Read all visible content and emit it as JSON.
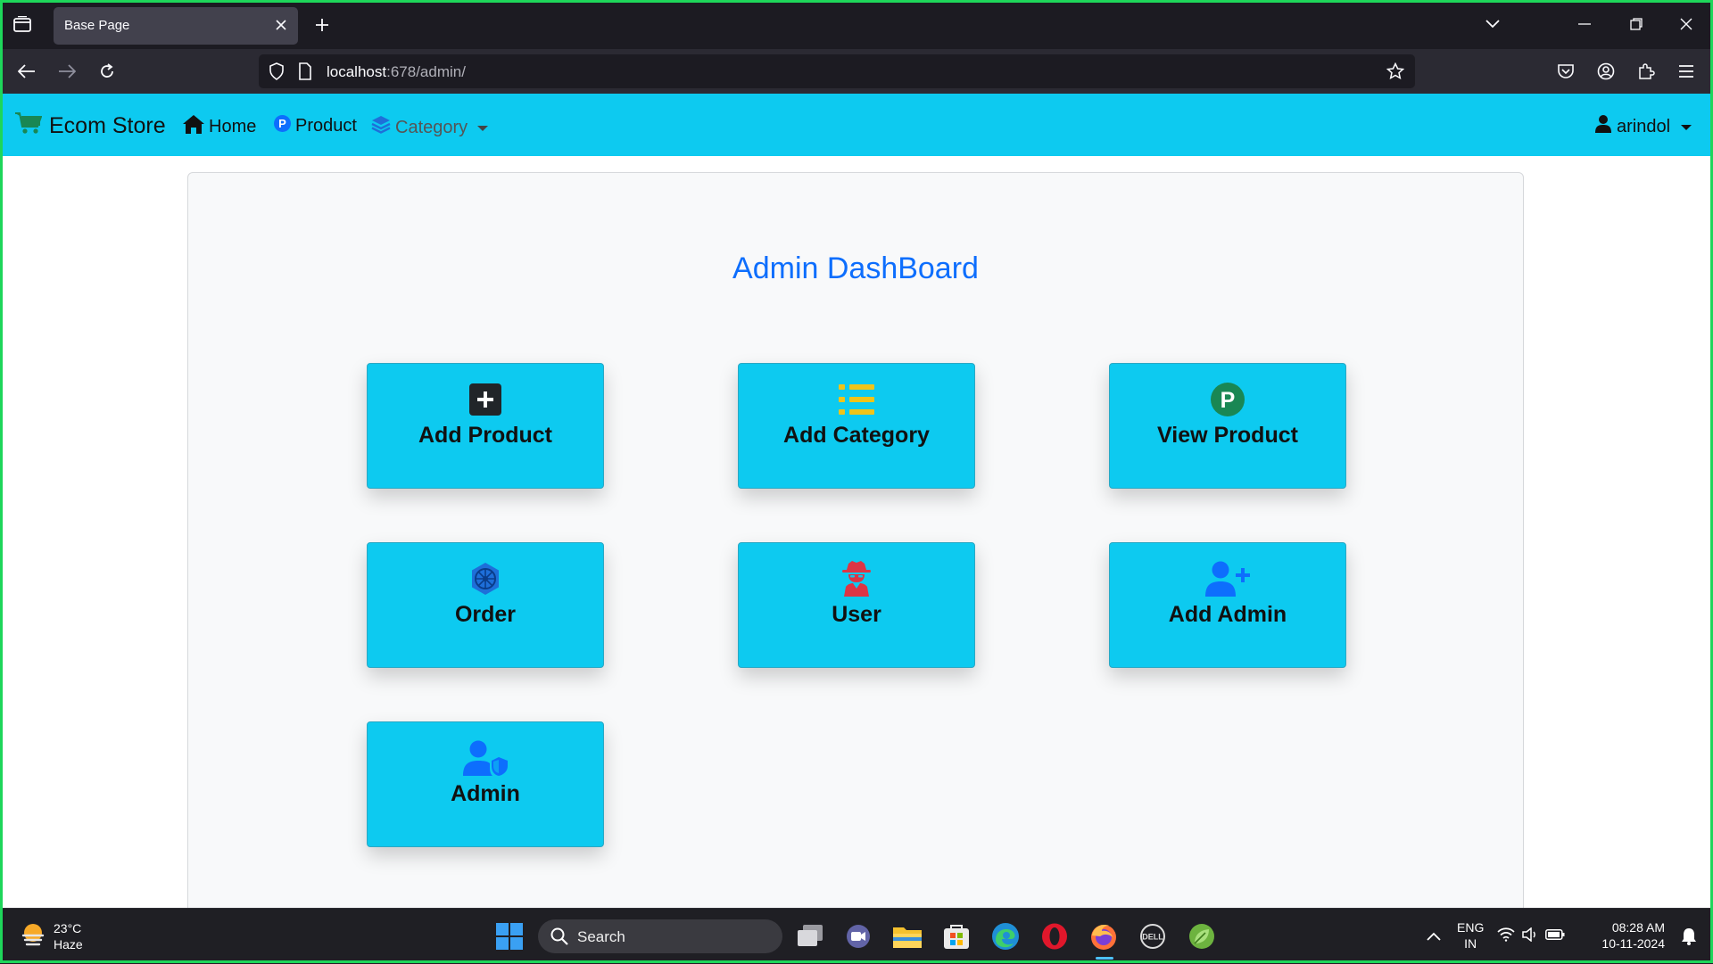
{
  "browser": {
    "tab_title": "Base Page",
    "url_host": "localhost",
    "url_path": ":678/admin/"
  },
  "app": {
    "brand": "Ecom Store",
    "nav": {
      "home": "Home",
      "product": "Product",
      "category": "Category",
      "user": "arindol"
    },
    "title": "Admin DashBoard",
    "tiles": [
      {
        "label": "Add Product",
        "icon": "square-plus-icon"
      },
      {
        "label": "Add Category",
        "icon": "list-icon"
      },
      {
        "label": "View Product",
        "icon": "product-p-icon"
      },
      {
        "label": "Order",
        "icon": "order-badge-icon"
      },
      {
        "label": "User",
        "icon": "user-secret-icon"
      },
      {
        "label": "Add Admin",
        "icon": "user-plus-icon"
      },
      {
        "label": "Admin",
        "icon": "user-shield-icon"
      }
    ],
    "colors": {
      "navbar": "#0dcaf0",
      "tile": "#0dcaf0",
      "title": "#0d6efd"
    }
  },
  "taskbar": {
    "temp": "23°C",
    "condition": "Haze",
    "search": "Search",
    "lang1": "ENG",
    "lang2": "IN",
    "time": "08:28 AM",
    "date": "10-11-2024"
  }
}
